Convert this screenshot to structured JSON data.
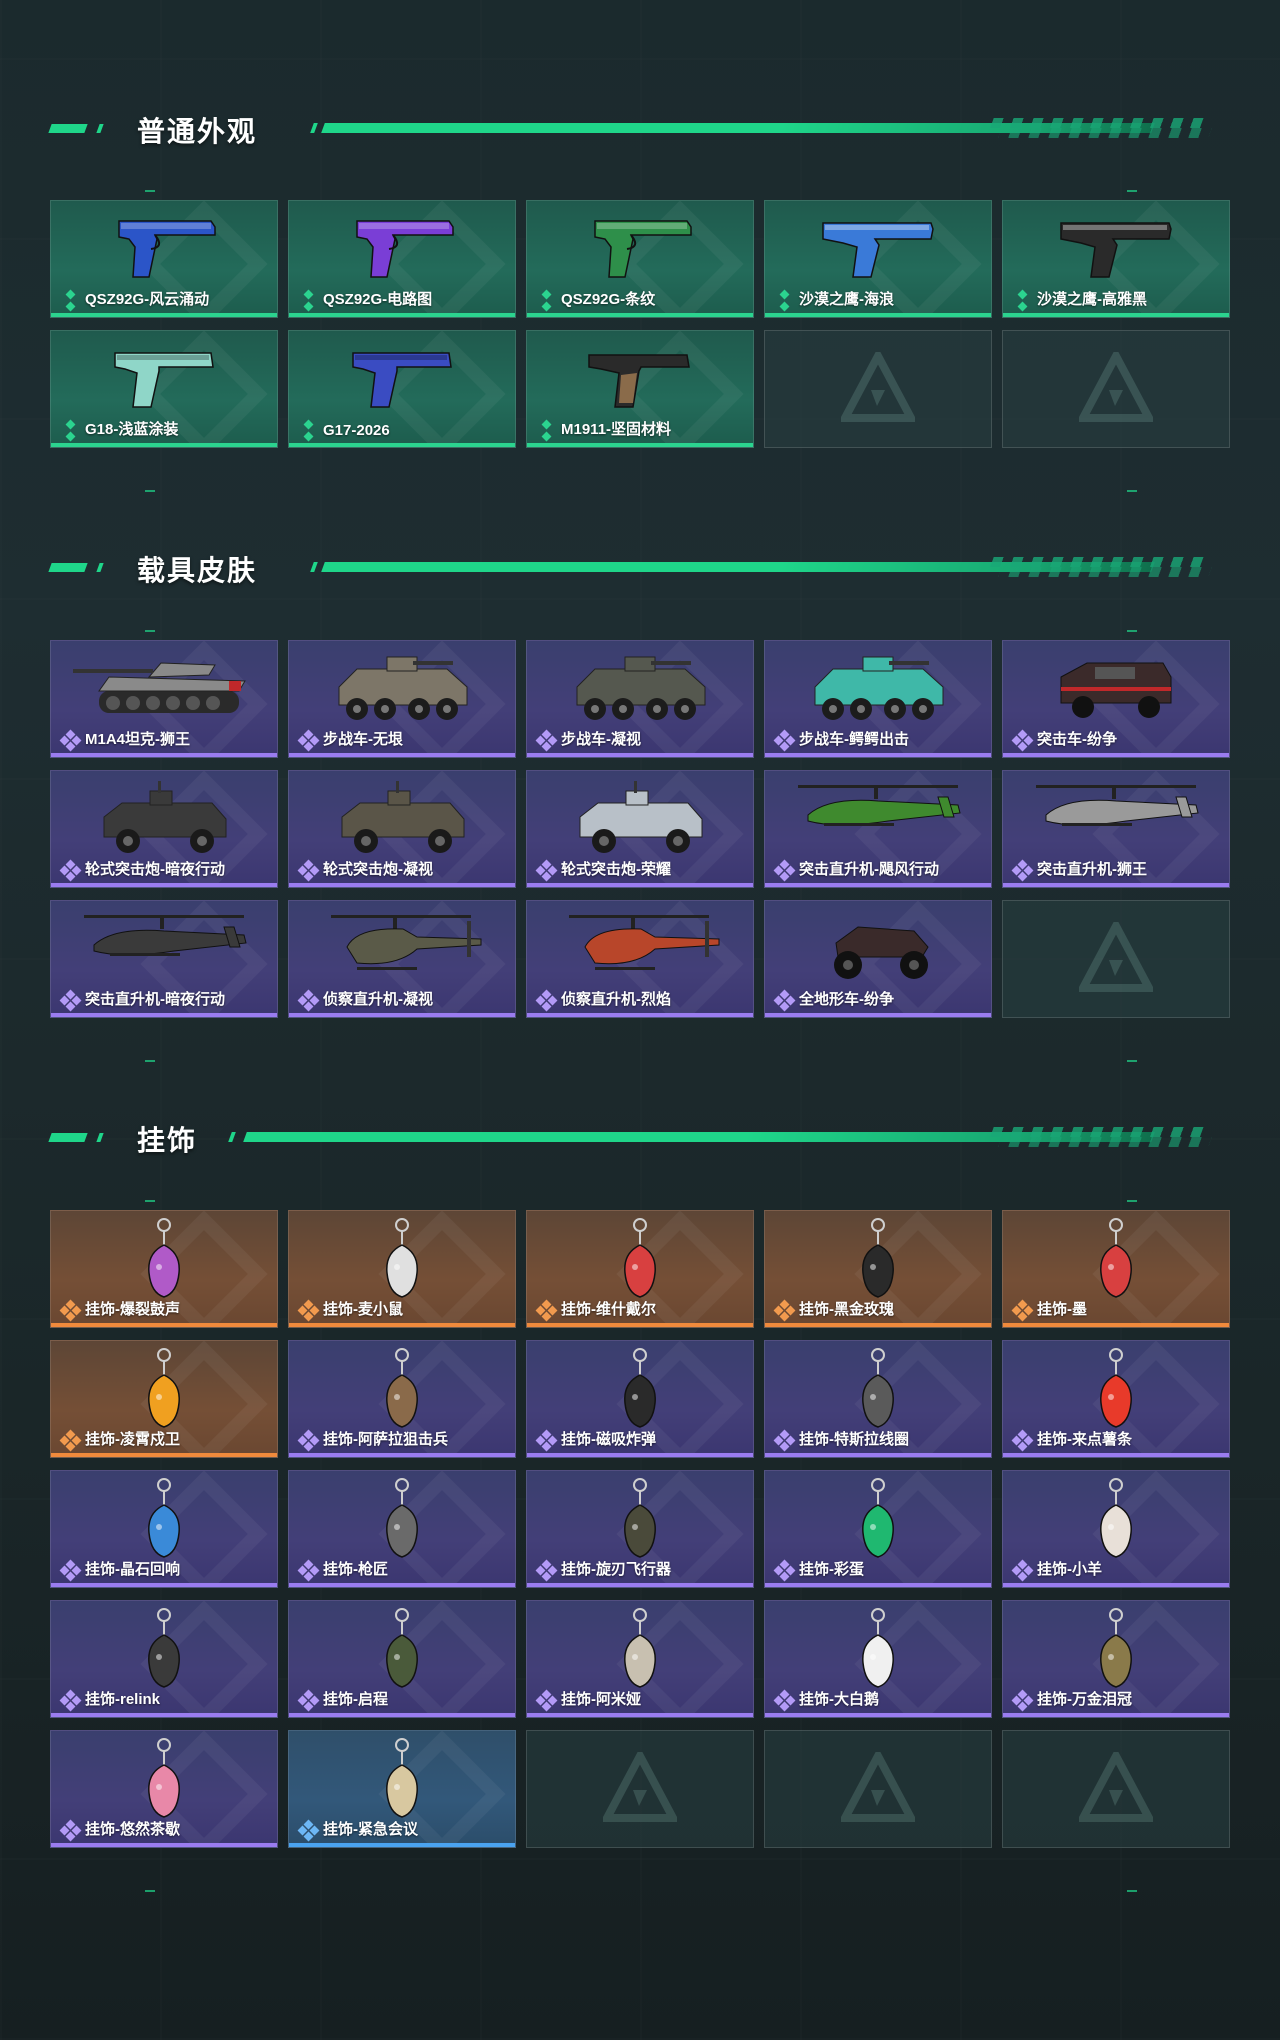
{
  "sections": [
    {
      "title": "普通外观",
      "items": [
        {
          "name": "QSZ92G-风云涌动",
          "rarity": "green",
          "art": "pistol",
          "color": "#2b55c8"
        },
        {
          "name": "QSZ92G-电路图",
          "rarity": "green",
          "art": "pistol",
          "color": "#7a3ed6"
        },
        {
          "name": "QSZ92G-条纹",
          "rarity": "green",
          "art": "pistol",
          "color": "#2e8f4a"
        },
        {
          "name": "沙漠之鹰-海浪",
          "rarity": "green",
          "art": "deagle",
          "color": "#3a7ad8"
        },
        {
          "name": "沙漠之鹰-高雅黑",
          "rarity": "green",
          "art": "deagle",
          "color": "#2a2a2a"
        },
        {
          "name": "G18-浅蓝涂装",
          "rarity": "green",
          "art": "glock",
          "color": "#8fd6c8"
        },
        {
          "name": "G17-2026",
          "rarity": "green",
          "art": "glock",
          "color": "#3a4cc2"
        },
        {
          "name": "M1911-坚固材料",
          "rarity": "green",
          "art": "m1911",
          "color": "#8a6b4a"
        },
        {
          "name": "",
          "rarity": "empty"
        },
        {
          "name": "",
          "rarity": "empty"
        }
      ]
    },
    {
      "title": "载具皮肤",
      "items": [
        {
          "name": "M1A4坦克-狮王",
          "rarity": "purple",
          "art": "tank",
          "color": "#8a8a8a"
        },
        {
          "name": "步战车-无垠",
          "rarity": "purple",
          "art": "apc",
          "color": "#7d7668"
        },
        {
          "name": "步战车-凝视",
          "rarity": "purple",
          "art": "apc",
          "color": "#55584f"
        },
        {
          "name": "步战车-鳄鳄出击",
          "rarity": "purple",
          "art": "apc",
          "color": "#3fb8a8"
        },
        {
          "name": "突击车-纷争",
          "rarity": "purple",
          "art": "truck",
          "color": "#3b2a2a"
        },
        {
          "name": "轮式突击炮-暗夜行动",
          "rarity": "purple",
          "art": "armored",
          "color": "#3a3a3a"
        },
        {
          "name": "轮式突击炮-凝视",
          "rarity": "purple",
          "art": "armored",
          "color": "#5a5548"
        },
        {
          "name": "轮式突击炮-荣耀",
          "rarity": "purple",
          "art": "armored",
          "color": "#b8c0c8"
        },
        {
          "name": "突击直升机-飓风行动",
          "rarity": "purple",
          "art": "heli",
          "color": "#3f8a2e"
        },
        {
          "name": "突击直升机-狮王",
          "rarity": "purple",
          "art": "heli",
          "color": "#9a9a9a"
        },
        {
          "name": "突击直升机-暗夜行动",
          "rarity": "purple",
          "art": "heli",
          "color": "#3a3a3a"
        },
        {
          "name": "侦察直升机-凝视",
          "rarity": "purple",
          "art": "scout",
          "color": "#5a5a48"
        },
        {
          "name": "侦察直升机-烈焰",
          "rarity": "purple",
          "art": "scout",
          "color": "#b8462a"
        },
        {
          "name": "全地形车-纷争",
          "rarity": "purple",
          "art": "atv",
          "color": "#3a2a2a"
        },
        {
          "name": "",
          "rarity": "empty"
        }
      ]
    },
    {
      "title": "挂饰",
      "items": [
        {
          "name": "挂饰-爆裂鼓声",
          "rarity": "orange",
          "art": "charm",
          "color": "#b05ac8"
        },
        {
          "name": "挂饰-麦小鼠",
          "rarity": "orange",
          "art": "charm",
          "color": "#e0e0e0"
        },
        {
          "name": "挂饰-维什戴尔",
          "rarity": "orange",
          "art": "charm",
          "color": "#d84040"
        },
        {
          "name": "挂饰-黑金玫瑰",
          "rarity": "orange",
          "art": "charm",
          "color": "#2a2a2a"
        },
        {
          "name": "挂饰-墨",
          "rarity": "orange",
          "art": "charm",
          "color": "#d84040"
        },
        {
          "name": "挂饰-凌霄戍卫",
          "rarity": "orange",
          "art": "charm",
          "color": "#f0a020"
        },
        {
          "name": "挂饰-阿萨拉狙击兵",
          "rarity": "purple",
          "art": "charm",
          "color": "#8a6a4a"
        },
        {
          "name": "挂饰-磁吸炸弹",
          "rarity": "purple",
          "art": "charm",
          "color": "#2a2a2a"
        },
        {
          "name": "挂饰-特斯拉线圈",
          "rarity": "purple",
          "art": "charm",
          "color": "#5a5a5a"
        },
        {
          "name": "挂饰-来点薯条",
          "rarity": "purple",
          "art": "charm",
          "color": "#e83a2a"
        },
        {
          "name": "挂饰-晶石回响",
          "rarity": "purple",
          "art": "charm",
          "color": "#3a8ad8"
        },
        {
          "name": "挂饰-枪匠",
          "rarity": "purple",
          "art": "charm",
          "color": "#6a6a6a"
        },
        {
          "name": "挂饰-旋刃飞行器",
          "rarity": "purple",
          "art": "charm",
          "color": "#4a4a3a"
        },
        {
          "name": "挂饰-彩蛋",
          "rarity": "purple",
          "art": "charm",
          "color": "#1fb870"
        },
        {
          "name": "挂饰-小羊",
          "rarity": "purple",
          "art": "charm",
          "color": "#e8e0d8"
        },
        {
          "name": "挂饰-relink",
          "rarity": "purple",
          "art": "charm",
          "color": "#3a3a3a"
        },
        {
          "name": "挂饰-启程",
          "rarity": "purple",
          "art": "charm",
          "color": "#4a5a3a"
        },
        {
          "name": "挂饰-阿米娅",
          "rarity": "purple",
          "art": "charm",
          "color": "#c8c0b0"
        },
        {
          "name": "挂饰-大白鹅",
          "rarity": "purple",
          "art": "charm",
          "color": "#f0f0f0"
        },
        {
          "name": "挂饰-万金泪冠",
          "rarity": "purple",
          "art": "charm",
          "color": "#8a7a4a"
        },
        {
          "name": "挂饰-悠然茶歇",
          "rarity": "purple",
          "art": "charm",
          "color": "#e888a8"
        },
        {
          "name": "挂饰-紧急会议",
          "rarity": "blue",
          "art": "charm",
          "color": "#d8c8a0"
        },
        {
          "name": "",
          "rarity": "empty"
        },
        {
          "name": "",
          "rarity": "empty"
        },
        {
          "name": "",
          "rarity": "empty"
        }
      ]
    }
  ]
}
